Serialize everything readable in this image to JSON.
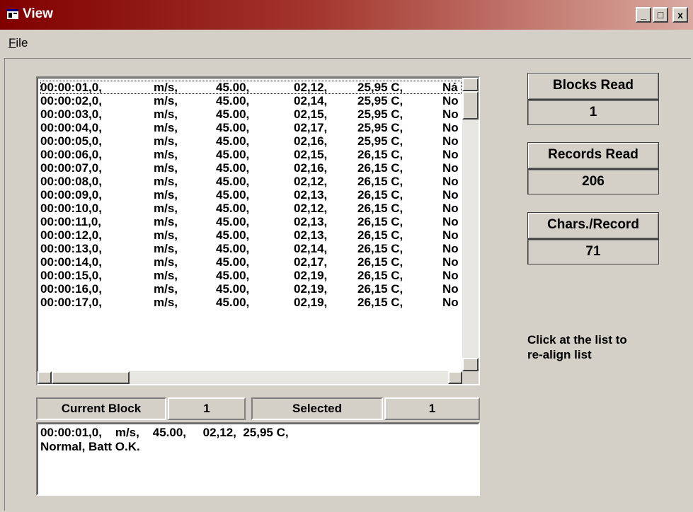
{
  "window": {
    "title": "View",
    "buttons": {
      "minimize": "_",
      "maximize": "□",
      "close": "x"
    }
  },
  "menu": {
    "file_mnemonic": "F",
    "file_rest": "ile"
  },
  "list": {
    "rows": [
      [
        "00:00:01,0,",
        "m/s,",
        "45.00,",
        "02,12,",
        "25,95 C,",
        "Ná"
      ],
      [
        "00:00:02,0,",
        "m/s,",
        "45.00,",
        "02,14,",
        "25,95 C,",
        "No"
      ],
      [
        "00:00:03,0,",
        "m/s,",
        "45.00,",
        "02,15,",
        "25,95 C,",
        "No"
      ],
      [
        "00:00:04,0,",
        "m/s,",
        "45.00,",
        "02,17,",
        "25,95 C,",
        "No"
      ],
      [
        "00:00:05,0,",
        "m/s,",
        "45.00,",
        "02,16,",
        "25,95 C,",
        "No"
      ],
      [
        "00:00:06,0,",
        "m/s,",
        "45.00,",
        "02,15,",
        "26,15 C,",
        "No"
      ],
      [
        "00:00:07,0,",
        "m/s,",
        "45.00,",
        "02,16,",
        "26,15 C,",
        "No"
      ],
      [
        "00:00:08,0,",
        "m/s,",
        "45.00,",
        "02,12,",
        "26,15 C,",
        "No"
      ],
      [
        "00:00:09,0,",
        "m/s,",
        "45.00,",
        "02,13,",
        "26,15 C,",
        "No"
      ],
      [
        "00:00:10,0,",
        "m/s,",
        "45.00,",
        "02,12,",
        "26,15 C,",
        "No"
      ],
      [
        "00:00:11,0,",
        "m/s,",
        "45.00,",
        "02,13,",
        "26,15 C,",
        "No"
      ],
      [
        "00:00:12,0,",
        "m/s,",
        "45.00,",
        "02,13,",
        "26,15 C,",
        "No"
      ],
      [
        "00:00:13,0,",
        "m/s,",
        "45.00,",
        "02,14,",
        "26,15 C,",
        "No"
      ],
      [
        "00:00:14,0,",
        "m/s,",
        "45.00,",
        "02,17,",
        "26,15 C,",
        "No"
      ],
      [
        "00:00:15,0,",
        "m/s,",
        "45.00,",
        "02,19,",
        "26,15 C,",
        "No"
      ],
      [
        "00:00:16,0,",
        "m/s,",
        "45.00,",
        "02,19,",
        "26,15 C,",
        "No"
      ],
      [
        "00:00:17,0,",
        "m/s,",
        "45.00,",
        "02,19,",
        "26,15 C,",
        "No"
      ]
    ]
  },
  "status": {
    "current_block_label": "Current Block",
    "current_block_value": "1",
    "selected_label": "Selected",
    "selected_value": "1"
  },
  "detail": {
    "line1": "00:00:01,0,    m/s,    45.00,     02,12,  25,95 C,",
    "line2": "Normal, Batt O.K."
  },
  "info": {
    "blocks_read_label": "Blocks Read",
    "blocks_read_value": "1",
    "records_read_label": "Records Read",
    "records_read_value": "206",
    "chars_per_record_label": "Chars./Record",
    "chars_per_record_value": "71"
  },
  "hint": {
    "line1": "Click at the list to",
    "line2": "re-align list"
  },
  "icons": {
    "app": "view-app-icon",
    "scroll_up": "arrow-up-icon",
    "scroll_down": "arrow-down-icon",
    "scroll_left": "arrow-left-icon",
    "scroll_right": "arrow-right-icon"
  },
  "colors": {
    "title_start": "#800000",
    "title_end": "#d9aaa0",
    "face": "#d4d0c8"
  }
}
